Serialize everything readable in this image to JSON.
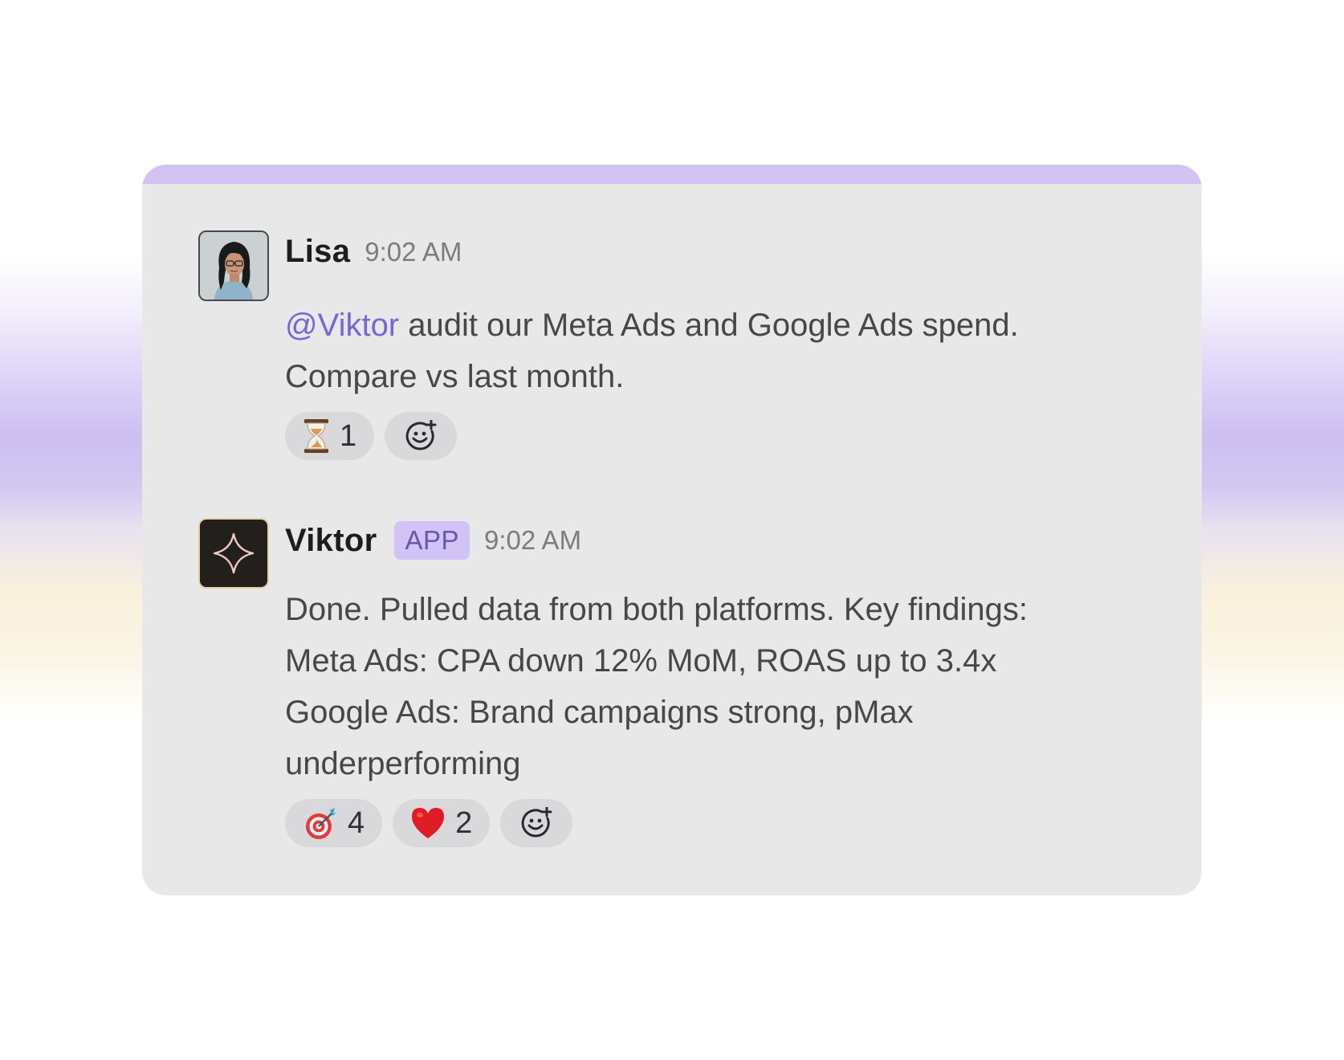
{
  "messages": [
    {
      "sender": "Lisa",
      "time": "9:02 AM",
      "avatar": "profile-photo",
      "mention": "@Viktor",
      "text_after_mention": " audit our Meta Ads and Google Ads spend.",
      "text_line_2": "Compare vs last month.",
      "reactions": [
        {
          "emoji": "hourglass-icon",
          "count": "1"
        }
      ],
      "add_reaction_icon": "add-reaction-icon"
    },
    {
      "sender": "Viktor",
      "badge": "APP",
      "time": "9:02 AM",
      "avatar": "sparkle-logo-icon",
      "lines": [
        "Done. Pulled data from both platforms. Key findings:",
        "Meta Ads: CPA down 12% MoM, ROAS up to 3.4x",
        "Google Ads: Brand campaigns strong, pMax",
        "underperforming"
      ],
      "reactions": [
        {
          "emoji": "target-icon",
          "count": "4"
        },
        {
          "emoji": "heart-icon",
          "count": "2"
        }
      ],
      "add_reaction_icon": "add-reaction-icon"
    }
  ],
  "colors": {
    "mention": "#7b65d6",
    "badge_bg": "#d1c3f5",
    "card_bg": "#e8e8e9",
    "card_topbar": "#d2c3f2"
  }
}
